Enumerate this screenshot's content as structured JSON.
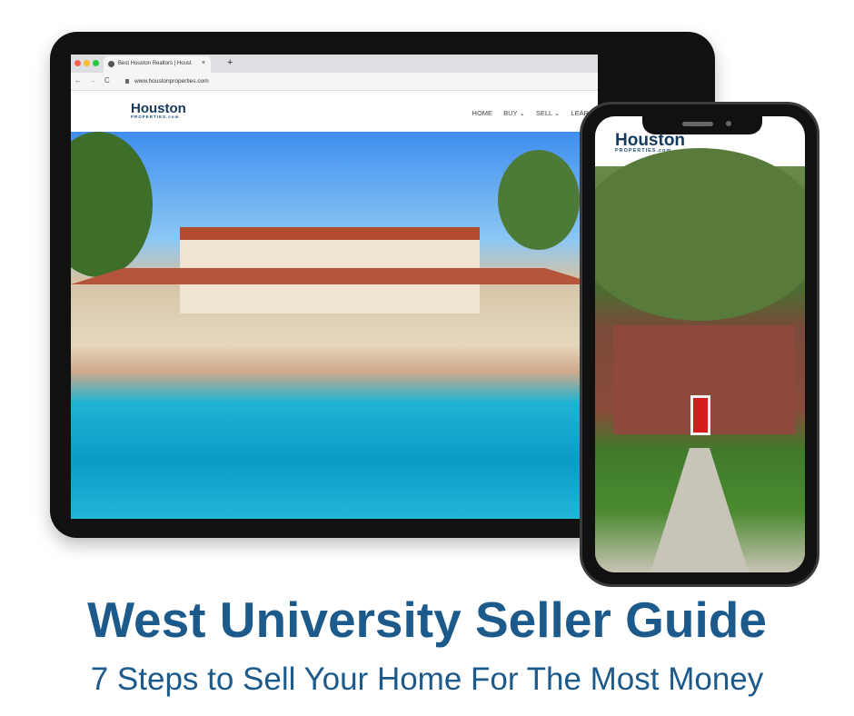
{
  "browser": {
    "tab_title": "Best Houston Realtors | Houst",
    "tab_close": "×",
    "new_tab": "+",
    "back": "←",
    "forward": "→",
    "reload": "C",
    "url": "www.houstonproperties.com"
  },
  "site": {
    "logo_main": "Houston",
    "logo_sub": "PROPERTIES.com",
    "nav": [
      "HOME",
      "BUY ⌄",
      "SELL ⌄",
      "LEAR"
    ]
  },
  "phone": {
    "logo_main": "Houston",
    "logo_sub": "PROPERTIES.com"
  },
  "headline": "West University Seller Guide",
  "subheadline": "7 Steps to Sell Your Home For The Most Money",
  "colors": {
    "headline": "#1d5a8c",
    "logo": "#16395c"
  }
}
